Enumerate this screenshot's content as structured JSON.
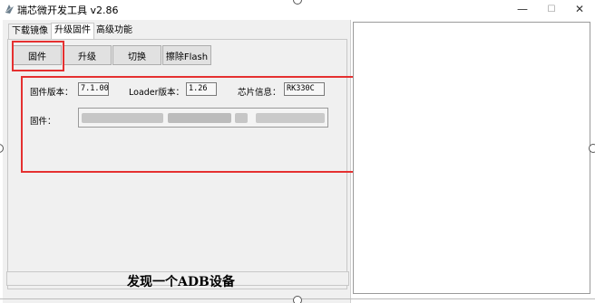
{
  "window": {
    "title": "瑞芯微开发工具 v2.86",
    "controls": {
      "minimize": "—",
      "maximize": "☐",
      "close": "✕"
    }
  },
  "tabs": [
    {
      "label": "下载镜像",
      "active": false
    },
    {
      "label": "升级固件",
      "active": true
    },
    {
      "label": "高级功能",
      "active": false
    }
  ],
  "toolbar": {
    "firmware": "固件",
    "upgrade": "升级",
    "switch": "切换",
    "erase_flash": "擦除Flash"
  },
  "info": {
    "firmware_version_label": "固件版本：",
    "firmware_version_value": "7.1.00",
    "loader_version_label": "Loader版本：",
    "loader_version_value": "1.26",
    "chip_info_label": "芯片信息：",
    "chip_info_value": "RK330C"
  },
  "firmware_path": {
    "label": "固件："
  },
  "status": {
    "message": "发现一个ADB设备"
  },
  "colors": {
    "highlight": "#e53030",
    "panel_bg": "#f0f0f0",
    "button_bg": "#e1e1e1"
  }
}
